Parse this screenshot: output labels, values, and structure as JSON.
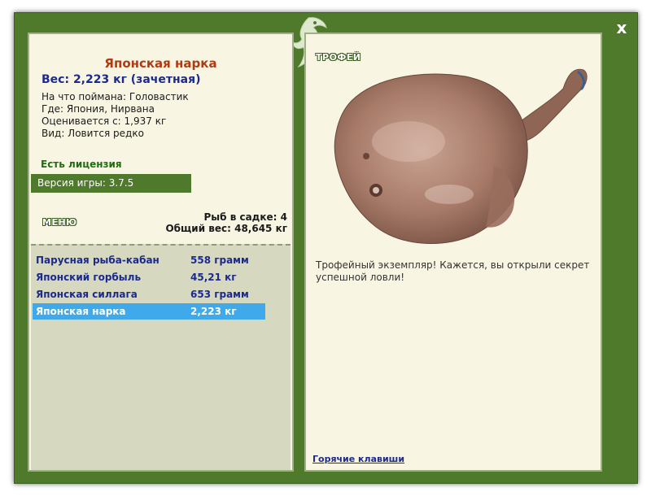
{
  "window": {
    "close_label": "x"
  },
  "fish": {
    "name": "Японская нарка",
    "weight_line": "Вес: 2,223 кг (зачетная)",
    "details": [
      "На что поймана: Головастик",
      "Где: Япония, Нирвана",
      "Оценивается с: 1,937 кг",
      "Вид: Ловится редко"
    ]
  },
  "license": "Есть лицензия",
  "version": "Версия игры: 3.7.5",
  "menu": {
    "label": "МЕНЮ"
  },
  "cage": {
    "fish_count": "Рыб в садке: 4",
    "total_weight": "Общий вес: 48,645 кг"
  },
  "catch_list": [
    {
      "name": "Парусная рыба-кабан",
      "weight": "558 грамм",
      "selected": false
    },
    {
      "name": "Японский горбыль",
      "weight": "45,21 кг",
      "selected": false
    },
    {
      "name": "Японская силлага",
      "weight": "653 грамм",
      "selected": false
    },
    {
      "name": "Японская нарка",
      "weight": "2,223 кг",
      "selected": true
    }
  ],
  "trophy": {
    "label": "ТРОФЕЙ",
    "description": "Трофейный экземпляр! Кажется, вы открыли секрет успешной ловли!"
  },
  "hotkeys_link": "Горячие клавиши",
  "colors": {
    "frame_green": "#4f7a2c",
    "panel_bg": "#f8f6e2",
    "list_bg": "#d7d8c0",
    "selected_row": "#3fa9ea",
    "fish_name": "#b03a12",
    "navy_text": "#1c2a8c"
  },
  "icons": {
    "logo": "fish-logo-icon",
    "close": "close-icon"
  }
}
